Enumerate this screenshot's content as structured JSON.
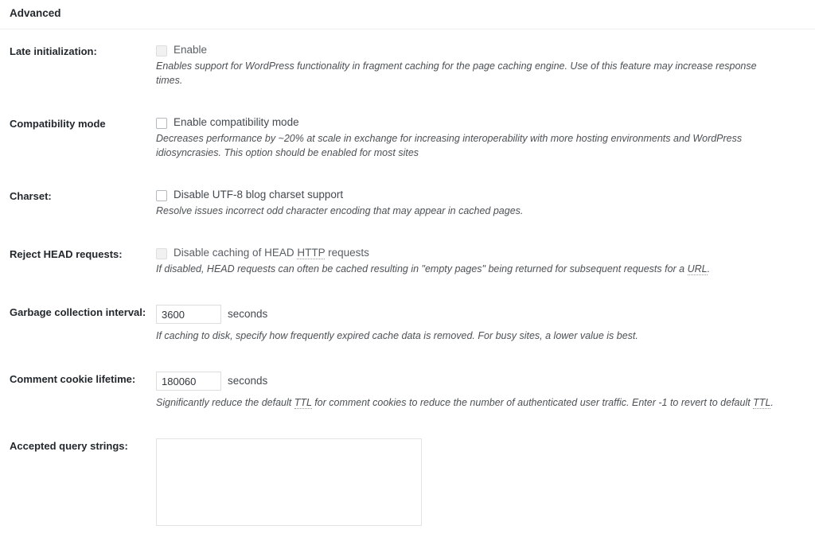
{
  "panel": {
    "title": "Advanced"
  },
  "rows": [
    {
      "label": "Late initialization:",
      "checkbox_label": "Enable",
      "checked": false,
      "disabled": true,
      "description": "Enables support for WordPress functionality in fragment caching for the page caching engine. Use of this feature may increase response times."
    },
    {
      "label": "Compatibility mode",
      "checkbox_label": "Enable compatibility mode",
      "checked": false,
      "disabled": false,
      "description": "Decreases performance by ~20% at scale in exchange for increasing interoperability with more hosting environments and WordPress idiosyncrasies. This option should be enabled for most sites"
    },
    {
      "label": "Charset:",
      "checkbox_label": "Disable UTF-8 blog charset support",
      "checked": false,
      "disabled": false,
      "description": "Resolve issues incorrect odd character encoding that may appear in cached pages."
    },
    {
      "label": "Reject HEAD requests:",
      "checkbox_label_pre": "Disable caching of HEAD ",
      "checkbox_abbr": "HTTP",
      "checkbox_label_post": " requests",
      "checked": false,
      "disabled": true,
      "description_pre": "If disabled, HEAD requests can often be cached resulting in \"empty pages\" being returned for subsequent requests for a ",
      "description_abbr": "URL",
      "description_post": "."
    },
    {
      "label": "Garbage collection interval:",
      "value": "3600",
      "unit": "seconds",
      "description": "If caching to disk, specify how frequently expired cache data is removed. For busy sites, a lower value is best."
    },
    {
      "label": "Comment cookie lifetime:",
      "value": "180060",
      "unit": "seconds",
      "description_pre": "Significantly reduce the default ",
      "description_abbr1": "TTL",
      "description_mid": " for comment cookies to reduce the number of authenticated user traffic. Enter -1 to revert to default ",
      "description_abbr2": "TTL",
      "description_post": "."
    },
    {
      "label": "Accepted query strings:",
      "textarea_value": "",
      "textarea_placeholder": ""
    }
  ]
}
